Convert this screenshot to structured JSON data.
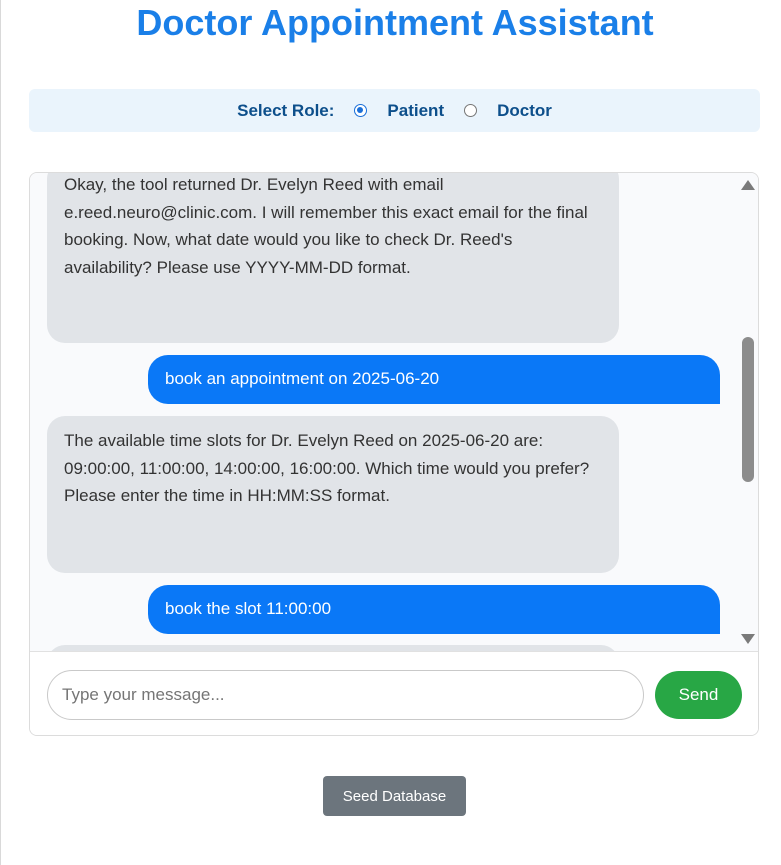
{
  "page": {
    "title": "Doctor Appointment Assistant"
  },
  "role_selector": {
    "label": "Select Role:",
    "options": [
      "Patient",
      "Doctor"
    ],
    "selected": "Patient"
  },
  "chat": {
    "messages": [
      {
        "sender": "assistant",
        "text": "Okay, the tool returned Dr. Evelyn Reed with email e.reed.neuro@clinic.com. I will remember this exact email for the final booking. Now, what date would you like to check Dr. Reed's availability? Please use YYYY-MM-DD format."
      },
      {
        "sender": "user",
        "text": "book an appointment on 2025-06-20"
      },
      {
        "sender": "assistant",
        "text": "The available time slots for Dr. Evelyn Reed on 2025-06-20 are: 09:00:00, 11:00:00, 14:00:00, 16:00:00. Which time would you prefer? Please enter the time in HH:MM:SS format."
      },
      {
        "sender": "user",
        "text": "book the slot 11:00:00"
      }
    ],
    "input_placeholder": "Type your message...",
    "input_value": "",
    "send_label": "Send"
  },
  "footer": {
    "seed_label": "Seed Database"
  },
  "colors": {
    "title": "#1a7fe8",
    "role_bar_bg": "#eaf4fc",
    "user_bubble": "#0a78f7",
    "bot_bubble": "#e1e4e8",
    "send_button": "#28a745",
    "seed_button": "#6c757d"
  }
}
